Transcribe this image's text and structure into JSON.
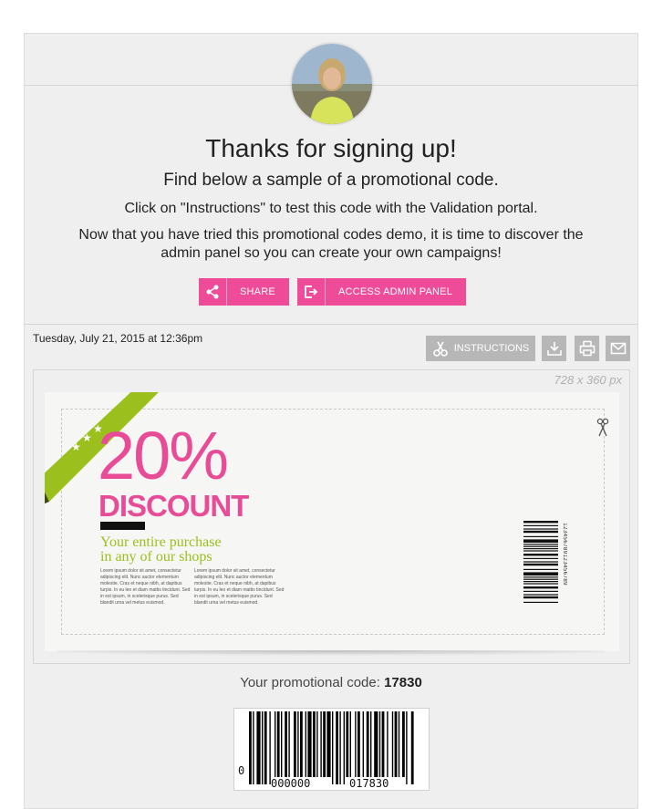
{
  "header": {
    "title": "Thanks for signing up!",
    "subtitle": "Find below a sample of a promotional code.",
    "instructions_text": "Click on \"Instructions\" to test this code with the Validation portal.",
    "discover_text": "Now that you have tried this promotional codes demo, it is time to discover the admin panel so you can create your own campaigns!"
  },
  "buttons": {
    "share": "SHARE",
    "admin": "ACCESS ADMIN PANEL"
  },
  "toolbar": {
    "date": "Tuesday, July 21, 2015 at 12:36pm",
    "instructions": "INSTRUCTIONS"
  },
  "coupon": {
    "dimensions": "728 x 360 px",
    "percent": "20%",
    "headline": "DISCOUNT",
    "tagline_1": "Your entire purchase",
    "tagline_2": "in any of our shops",
    "lorem_1": "Lorem ipsum dolor sit amet, consectetur adipiscing elit. Nunc auctor elementum molestie. Cras et neque nibh, at dapibus turpis. In eu leo et diam mattis tincidunt. Sed in est ipsum, in scelerisque purus. Sed blandit urna vel metus euismod.",
    "lorem_2": "Lorem ipsum dolor sit amet, consectetur adipiscing elit. Nunc auctor elementum molestie. Cras et neque nibh, at dapibus turpis. In eu leo et diam mattis tincidunt. Sed in est ipsum, in scelerisque purus. Sed blandit urna vel metus euismod.",
    "barcode_text": "123456789123456789"
  },
  "promo": {
    "label": "Your promotional code:",
    "code": "17830"
  },
  "barcode": {
    "lead": "0",
    "left_digits": "000000",
    "right_digits": "017830"
  },
  "colors": {
    "accent_pink": "#ee4c99",
    "lime": "#9bbf1c",
    "toolbar_gray": "#b7b7b7"
  }
}
